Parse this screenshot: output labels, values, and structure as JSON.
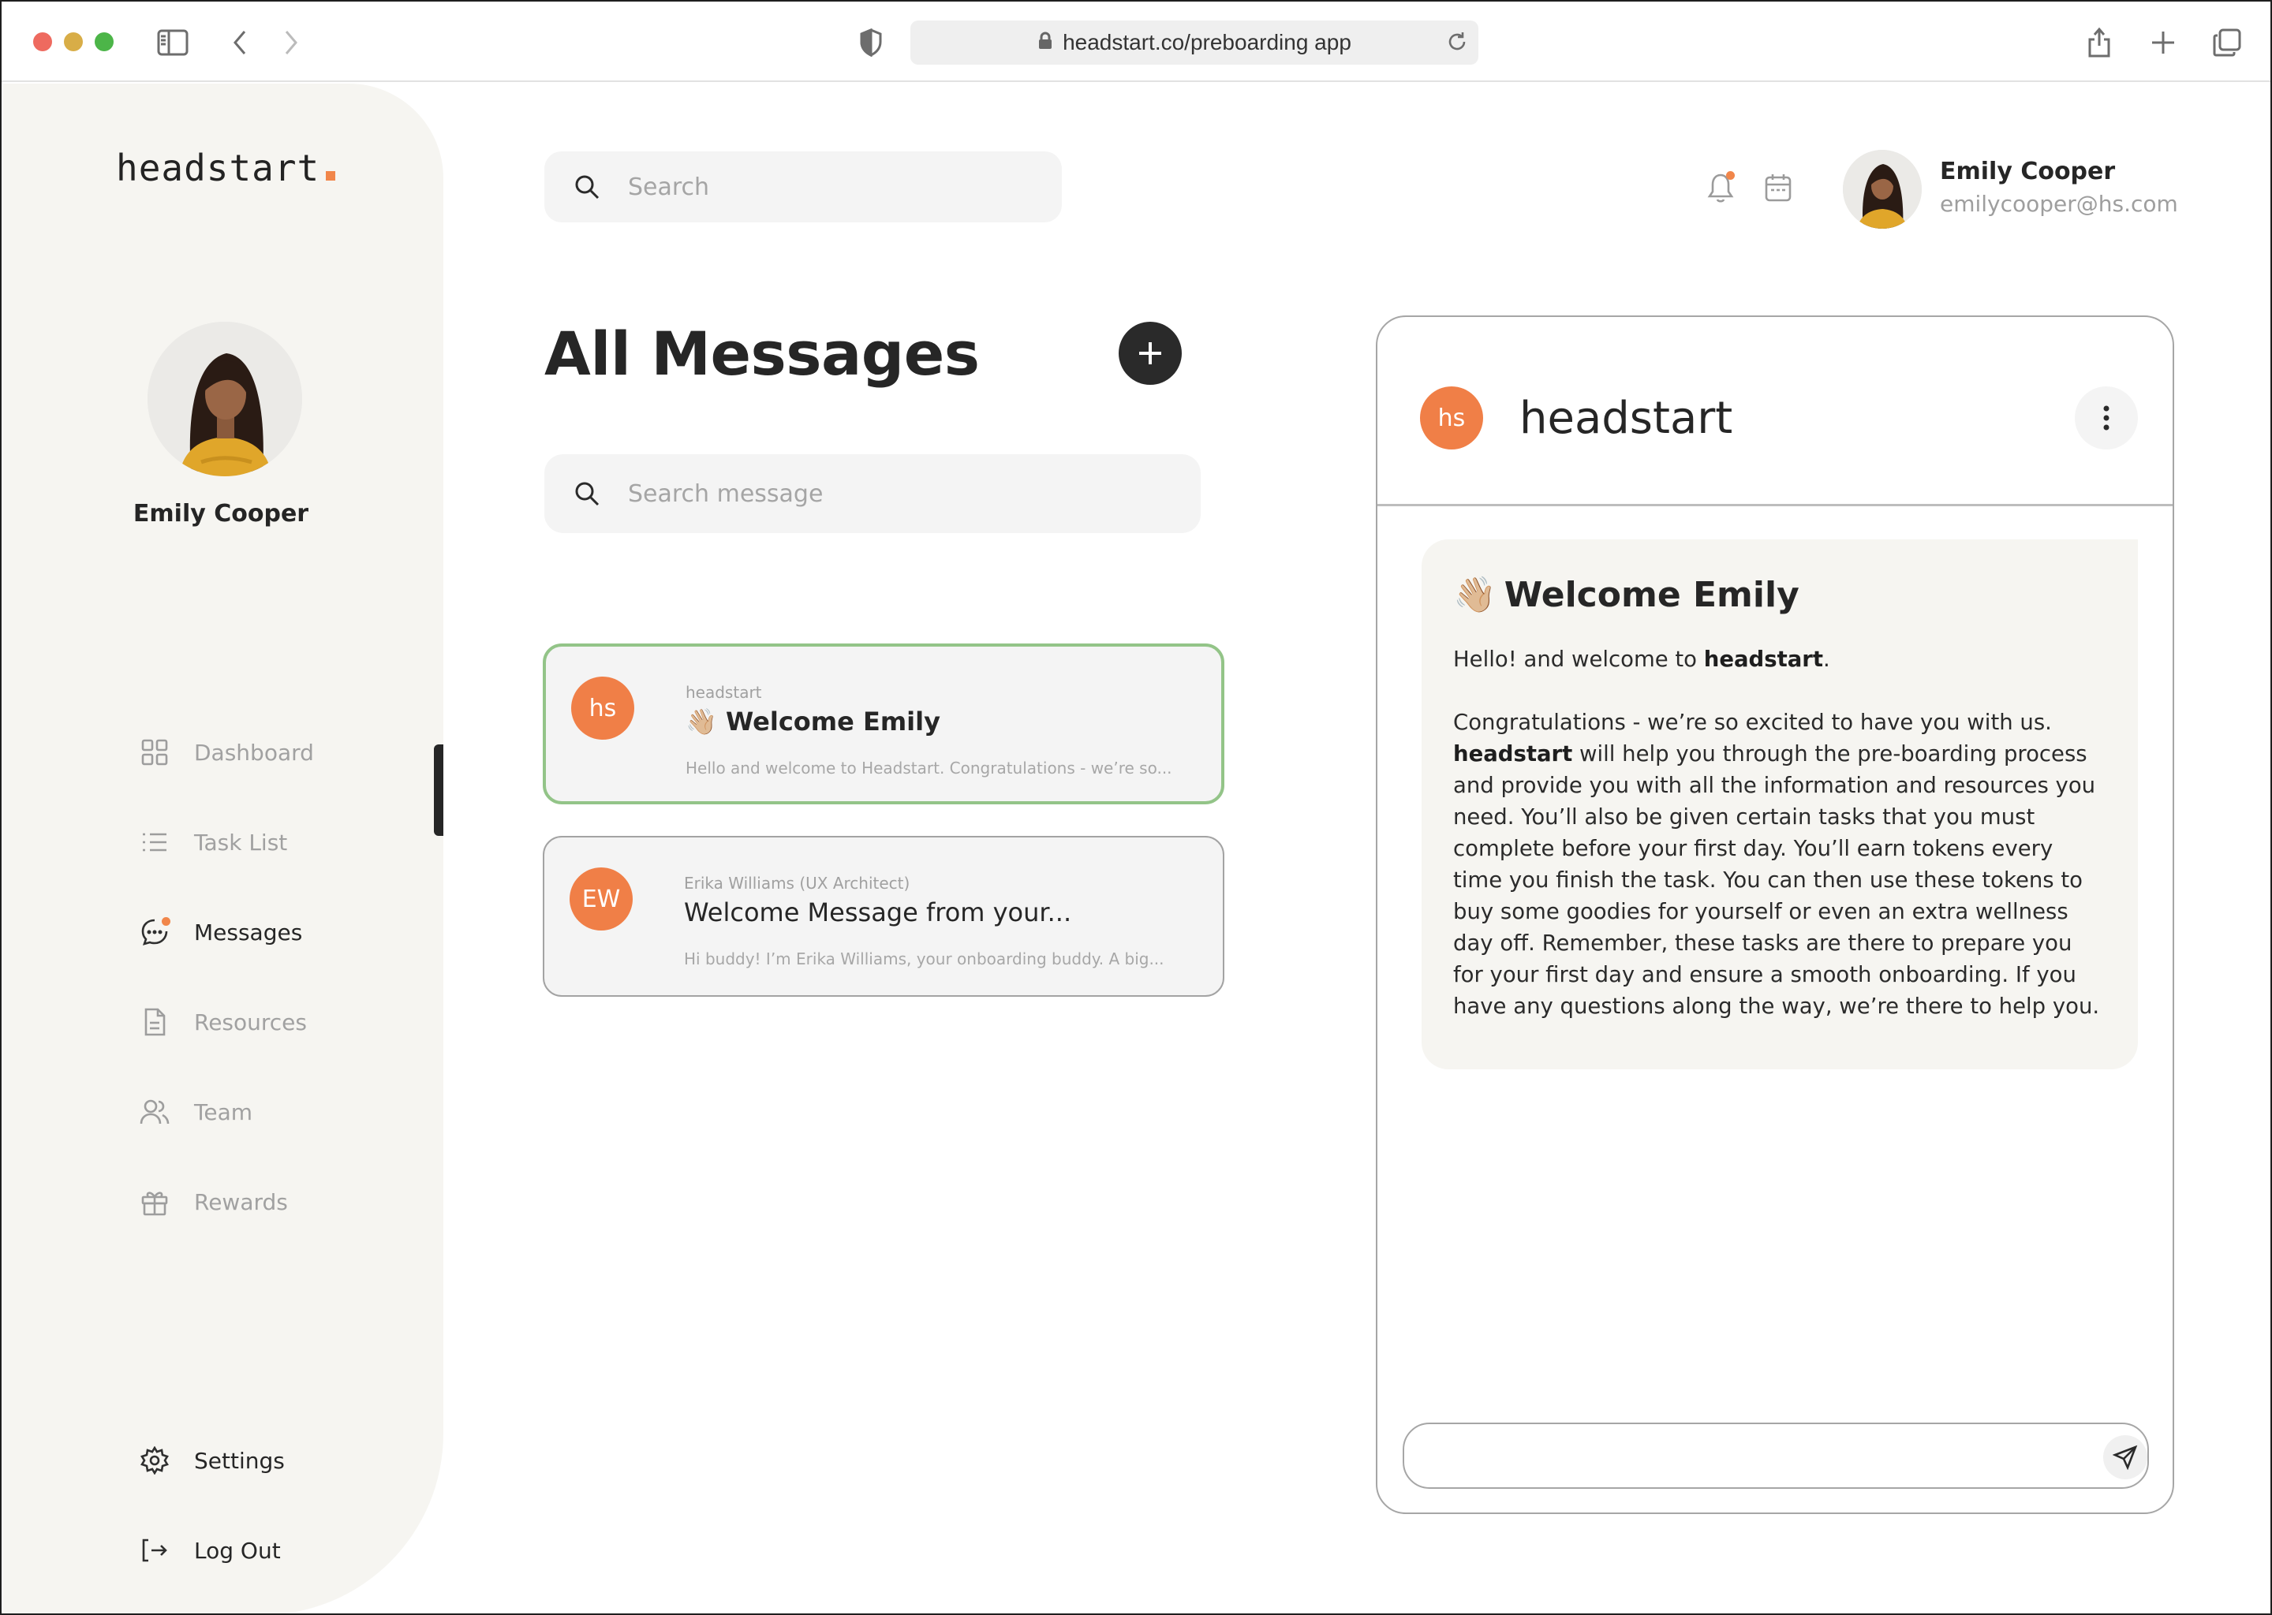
{
  "browser": {
    "url": "headstart.co/preboarding app"
  },
  "sidebar": {
    "logo": "headstart",
    "profile_name": "Emily Cooper",
    "nav": [
      {
        "label": "Dashboard",
        "icon": "grid-icon"
      },
      {
        "label": "Task List",
        "icon": "list-icon"
      },
      {
        "label": "Messages",
        "icon": "chat-icon",
        "active": true
      },
      {
        "label": "Resources",
        "icon": "document-icon"
      },
      {
        "label": "Team",
        "icon": "users-icon"
      },
      {
        "label": "Rewards",
        "icon": "gift-icon"
      }
    ],
    "settings_label": "Settings",
    "logout_label": "Log Out"
  },
  "topbar": {
    "search_placeholder": "Search",
    "user_name": "Emily Cooper",
    "user_email": "emilycooper@hs.com"
  },
  "messages": {
    "title": "All Messages",
    "search_placeholder": "Search message",
    "items": [
      {
        "avatar": "hs",
        "sender": "headstart",
        "subject": "Welcome Emily",
        "preview": "Hello and welcome to Headstart. Congratulations - we’re so...",
        "selected": true
      },
      {
        "avatar": "EW",
        "sender": "Erika Williams (UX Architect)",
        "subject": "Welcome Message from your...",
        "preview": "Hi buddy! I’m Erika Williams, your onboarding buddy. A big...",
        "selected": false
      }
    ]
  },
  "chat": {
    "avatar": "hs",
    "name": "headstart",
    "bubble": {
      "title": "Welcome Emily",
      "greeting_pre": "Hello! and welcome to ",
      "greeting_brand": "headstart",
      "greeting_post": ".",
      "para_intro": "Congratulations - we’re so excited to have you with us.",
      "para_brand": "headstart",
      "para_rest": " will help you through the pre-boarding process and provide you with all the information and resources you need. You’ll also be given certain tasks that you must complete before your first day. You’ll earn tokens every time you finish the task. You can then use these tokens to buy some goodies for yourself or even an extra wellness day off. Remember, these tasks are there to prepare you for your first day and ensure a smooth onboarding. If you have any questions along the way, we’re there to help you."
    },
    "composer_placeholder": ""
  },
  "colors": {
    "accent": "#f07f47",
    "selected_border": "#93c488",
    "sidebar_bg": "#f6f5f1"
  }
}
